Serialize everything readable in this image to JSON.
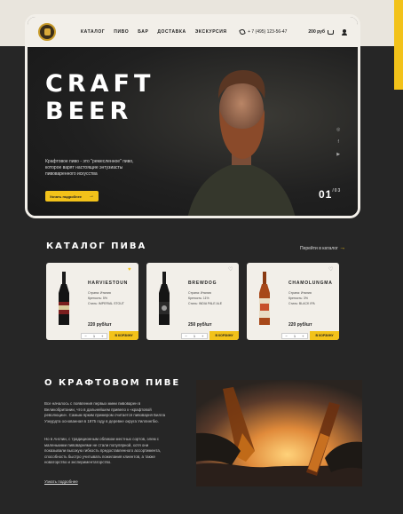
{
  "nav": {
    "links": [
      "Каталог",
      "Пиво",
      "Бар",
      "Доставка",
      "Экскурсия"
    ],
    "phone": "+ 7 (495) 123-56-47",
    "cart_total": "200 руб"
  },
  "hero": {
    "title_line1": "CRAFT",
    "title_line2": "BEER",
    "description": "Крафтовое пиво - это \"ремесленное\" пиво, которое варят настоящие энтузиасты пивоваренного искусства",
    "button_label": "Узнать подробнее",
    "slide_current": "01",
    "slide_total": "/03"
  },
  "catalog": {
    "title": "КАТАЛОГ ПИВА",
    "link": "Перейти в каталог",
    "cards": [
      {
        "name": "HARVIESTOUN",
        "country": "Страна: Италия",
        "strength": "Крепость: 5%",
        "style": "Стиль: IMPERIAL STOUT",
        "price": "220 руб/шт",
        "qty": "1",
        "button": "В КОРЗИНУ",
        "favorite": true
      },
      {
        "name": "BREWDOG",
        "country": "Страна: Италия",
        "strength": "Крепость: 11%",
        "style": "Стиль: INDIA PALE ALE",
        "price": "250 руб/шт",
        "qty": "1",
        "button": "В КОРЗИНУ",
        "favorite": false
      },
      {
        "name": "CHAMOLUNGMA",
        "country": "Страна: Италия",
        "strength": "Крепость: 3%",
        "style": "Стиль: BLACK IPA",
        "price": "220 руб/шт",
        "qty": "1",
        "button": "В КОРЗИНУ",
        "favorite": false
      }
    ]
  },
  "about": {
    "title": "О КРАФТОВОМ ПИВЕ",
    "paragraph1": "Все началось с появления первых мини пивоварен в Великобритании, что в дальнейшем привело к «крафтовой революции». Самым ярким примером считается пивоварня Билла Уэкурдта основанная в 1975 году в деревне округа Уиллингбю.",
    "paragraph2": "Но в Англии, с традиционным обликом местных сортов, элем с маленькими пивоварнями не стали популярной, хотя они показывали высокую гибкость предоставленного ассортимента, способность быстро учитывать пожелания клиентов, а также новаторство и экспериментаторство.",
    "link": "Узнать подробнее"
  }
}
